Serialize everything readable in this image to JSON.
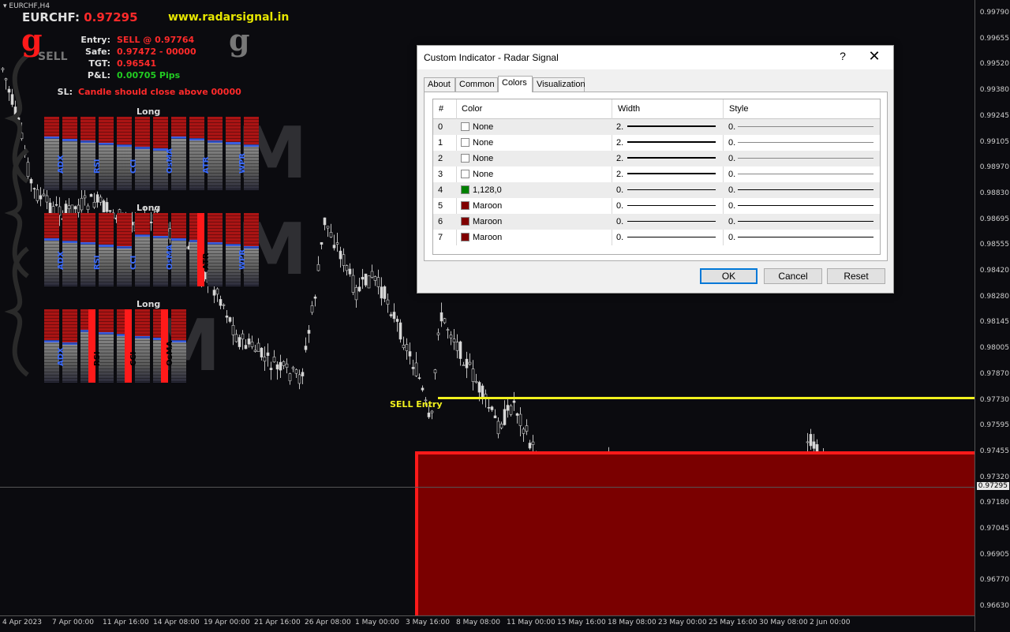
{
  "chart": {
    "tab_label": "EURCHF,H4",
    "symbol": "EURCHF:",
    "price": "0.97295",
    "website": "www.radarsignal.in",
    "logo_letter": "g",
    "logo_color_red": "#ff1a1a",
    "logo_color_gray": "#777777",
    "sell_word": "SELL",
    "info": [
      {
        "label": "Entry:",
        "value": "SELL @ 0.97764",
        "color": "#ff2a2a"
      },
      {
        "label": "Safe:",
        "value": "0.97472 - 00000",
        "color": "#ff2a2a"
      },
      {
        "label": "TGT:",
        "value": "0.96541",
        "color": "#ff2a2a"
      },
      {
        "label": "P&L:",
        "value": "0.00705  Pips",
        "color": "#22cc22"
      }
    ],
    "sl_label": "SL:",
    "sl_text": "Candle should close above 00000",
    "sl_color": "#ff2a2a",
    "panels": [
      {
        "title": "Long",
        "indicators": [
          "ADX",
          "RSI",
          "CCI",
          "OsMA",
          "ATR",
          "WPR"
        ]
      },
      {
        "title": "Long",
        "indicators": [
          "ADX",
          "RSI",
          "CCI",
          "OsMA",
          "ATR",
          "WPR"
        ]
      },
      {
        "title": "Long",
        "indicators": [
          "ADX",
          "RSI",
          "CCI",
          "OsMA"
        ]
      }
    ],
    "entry_label": "SELL Entry",
    "price_axis": [
      "0.99790",
      "0.99655",
      "0.99520",
      "0.99380",
      "0.99245",
      "0.99105",
      "0.98970",
      "0.98830",
      "0.98695",
      "0.98555",
      "0.98420",
      "0.98280",
      "0.98145",
      "0.98005",
      "0.97870",
      "0.97730",
      "0.97595",
      "0.97455",
      "0.97320",
      "0.97180",
      "0.97045",
      "0.96905",
      "0.96770",
      "0.96630"
    ],
    "current_price_tag": "0.97295",
    "date_axis": [
      "4 Apr 2023",
      "7 Apr 00:00",
      "11 Apr 16:00",
      "14 Apr 08:00",
      "19 Apr 00:00",
      "21 Apr 16:00",
      "26 Apr 08:00",
      "1 May 00:00",
      "3 May 16:00",
      "8 May 08:00",
      "11 May 00:00",
      "15 May 16:00",
      "18 May 08:00",
      "23 May 00:00",
      "25 May 16:00",
      "30 May 08:00",
      "2 Jun 00:00"
    ],
    "colors": {
      "entry_line": "#f2f21e",
      "sell_zone": "#7a0000",
      "sell_zone_border": "#ff1a1a",
      "candle": "#cfcfcf"
    }
  },
  "dialog": {
    "title": "Custom Indicator - Radar Signal",
    "help": "?",
    "close": "✕",
    "tabs": [
      "About",
      "Common",
      "Colors",
      "Visualization"
    ],
    "active_tab": "Colors",
    "headers": {
      "num": "#",
      "color": "Color",
      "width": "Width",
      "style": "Style"
    },
    "rows": [
      {
        "num": "0",
        "swatch": "#ffffff",
        "name": "None",
        "width": "2.",
        "style": "0."
      },
      {
        "num": "1",
        "swatch": "#ffffff",
        "name": "None",
        "width": "2.",
        "style": "0."
      },
      {
        "num": "2",
        "swatch": "#ffffff",
        "name": "None",
        "width": "2.",
        "style": "0."
      },
      {
        "num": "3",
        "swatch": "#ffffff",
        "name": "None",
        "width": "2.",
        "style": "0."
      },
      {
        "num": "4",
        "swatch": "#008000",
        "name": "1,128,0",
        "width": "0.",
        "style": "0."
      },
      {
        "num": "5",
        "swatch": "#800000",
        "name": "Maroon",
        "width": "0.",
        "style": "0."
      },
      {
        "num": "6",
        "swatch": "#800000",
        "name": "Maroon",
        "width": "0.",
        "style": "0."
      },
      {
        "num": "7",
        "swatch": "#800000",
        "name": "Maroon",
        "width": "0.",
        "style": "0."
      }
    ],
    "buttons": {
      "ok": "OK",
      "cancel": "Cancel",
      "reset": "Reset"
    }
  }
}
